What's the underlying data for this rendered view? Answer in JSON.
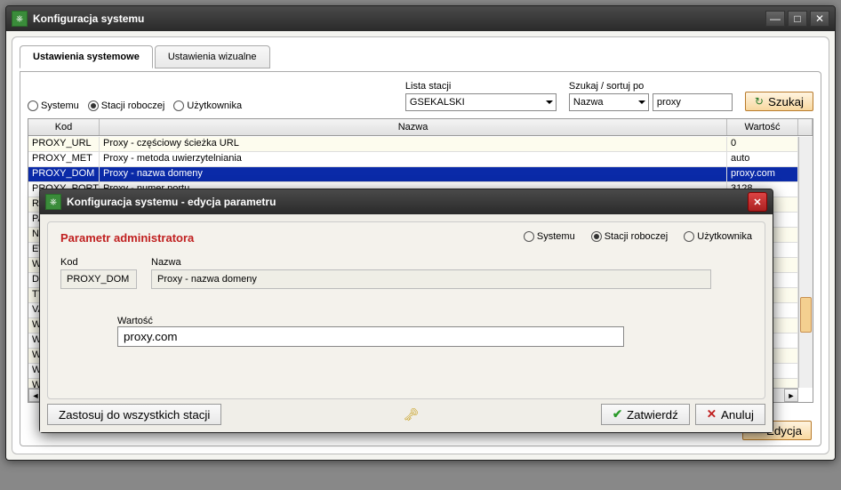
{
  "window": {
    "title": "Konfiguracja systemu"
  },
  "tabs": {
    "system": "Ustawienia systemowe",
    "visual": "Ustawienia wizualne"
  },
  "scope": {
    "system": "Systemu",
    "station": "Stacji roboczej",
    "user": "Użytkownika"
  },
  "filters": {
    "station_label": "Lista stacji",
    "station_value": "GSEKALSKI",
    "sort_label": "Szukaj / sortuj po",
    "sort_value": "Nazwa",
    "search_value": "proxy",
    "search_btn": "Szukaj"
  },
  "grid": {
    "col_kod": "Kod",
    "col_nazwa": "Nazwa",
    "col_wartosc": "Wartość",
    "rows": [
      {
        "kod": "PROXY_URL",
        "nazwa": "Proxy - częściowy ścieżka URL",
        "wart": "0"
      },
      {
        "kod": "PROXY_MET",
        "nazwa": "Proxy - metoda uwierzytelniania",
        "wart": "auto"
      },
      {
        "kod": "PROXY_DOM",
        "nazwa": "Proxy - nazwa domeny",
        "wart": "proxy.com"
      },
      {
        "kod": "PROXY_PORT",
        "nazwa": "Proxy - numer portu",
        "wart": "3128"
      },
      {
        "kod": "ROZL_",
        "nazwa": "",
        "wart": ""
      },
      {
        "kod": "PAP_",
        "nazwa": "",
        "wart": ""
      },
      {
        "kod": "NAGL",
        "nazwa": "",
        "wart": ""
      },
      {
        "kod": "EWUS",
        "nazwa": "",
        "wart": ""
      },
      {
        "kod": "WIZ_",
        "nazwa": "",
        "wart": ""
      },
      {
        "kod": "DRUK",
        "nazwa": "",
        "wart": ""
      },
      {
        "kod": "TYP_",
        "nazwa": "",
        "wart": ""
      },
      {
        "kod": "VAL_",
        "nazwa": "",
        "wart": ""
      },
      {
        "kod": "WYD",
        "nazwa": "",
        "wart": ""
      },
      {
        "kod": "WYD",
        "nazwa": "",
        "wart": ""
      },
      {
        "kod": "WYD",
        "nazwa": "",
        "wart": ""
      },
      {
        "kod": "WYD",
        "nazwa": "",
        "wart": ""
      },
      {
        "kod": "WYD",
        "nazwa": "",
        "wart": ""
      }
    ]
  },
  "edit_btn": "Edycja",
  "dialog": {
    "title": "Konfiguracja systemu - edycja parametru",
    "heading": "Parametr administratora",
    "kod_label": "Kod",
    "kod_value": "PROXY_DOM",
    "nazwa_label": "Nazwa",
    "nazwa_value": "Proxy - nazwa domeny",
    "wartosc_label": "Wartość",
    "wartosc_value": "proxy.com",
    "apply_all": "Zastosuj do wszystkich stacji",
    "ok": "Zatwierdź",
    "cancel": "Anuluj"
  }
}
